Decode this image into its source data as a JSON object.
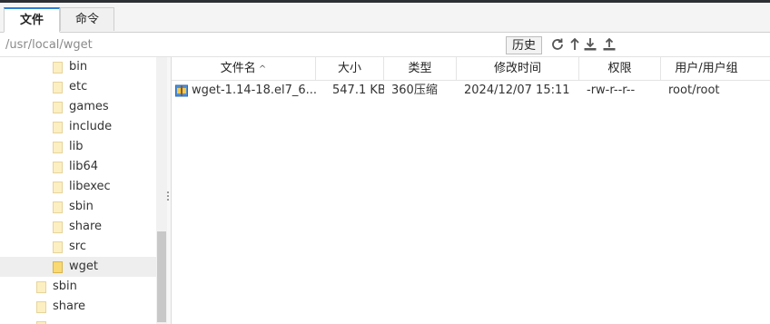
{
  "tabs": [
    {
      "label": "文件",
      "active": true
    },
    {
      "label": "命令",
      "active": false
    }
  ],
  "path": {
    "value": "/usr/local/wget",
    "history_label": "历史",
    "tools": [
      "refresh-icon",
      "up-arrow-icon",
      "download-icon",
      "upload-icon"
    ]
  },
  "tree": {
    "items": [
      {
        "label": "bin",
        "level": 2,
        "selected": false
      },
      {
        "label": "etc",
        "level": 2,
        "selected": false
      },
      {
        "label": "games",
        "level": 2,
        "selected": false
      },
      {
        "label": "include",
        "level": 2,
        "selected": false
      },
      {
        "label": "lib",
        "level": 2,
        "selected": false
      },
      {
        "label": "lib64",
        "level": 2,
        "selected": false
      },
      {
        "label": "libexec",
        "level": 2,
        "selected": false
      },
      {
        "label": "sbin",
        "level": 2,
        "selected": false
      },
      {
        "label": "share",
        "level": 2,
        "selected": false
      },
      {
        "label": "src",
        "level": 2,
        "selected": false
      },
      {
        "label": "wget",
        "level": 2,
        "selected": true
      },
      {
        "label": "sbin",
        "level": 1,
        "selected": false
      },
      {
        "label": "share",
        "level": 1,
        "selected": false
      }
    ]
  },
  "files": {
    "columns": [
      "文件名",
      "大小",
      "类型",
      "修改时间",
      "权限",
      "用户/用户组"
    ],
    "sort_indicator": "^",
    "rows": [
      {
        "name": "wget-1.14-18.el7_6....",
        "size": "547.1 KB",
        "type": "360压缩",
        "modified": "2024/12/07 15:11",
        "permissions": "-rw-r--r--",
        "owner": "root/root",
        "icon": "archive-icon"
      }
    ]
  },
  "colors": {
    "accent": "#2d7fd3",
    "folder": "#fcefc2",
    "folder_open": "#f8d973",
    "selected_row": "#eeeeee"
  }
}
